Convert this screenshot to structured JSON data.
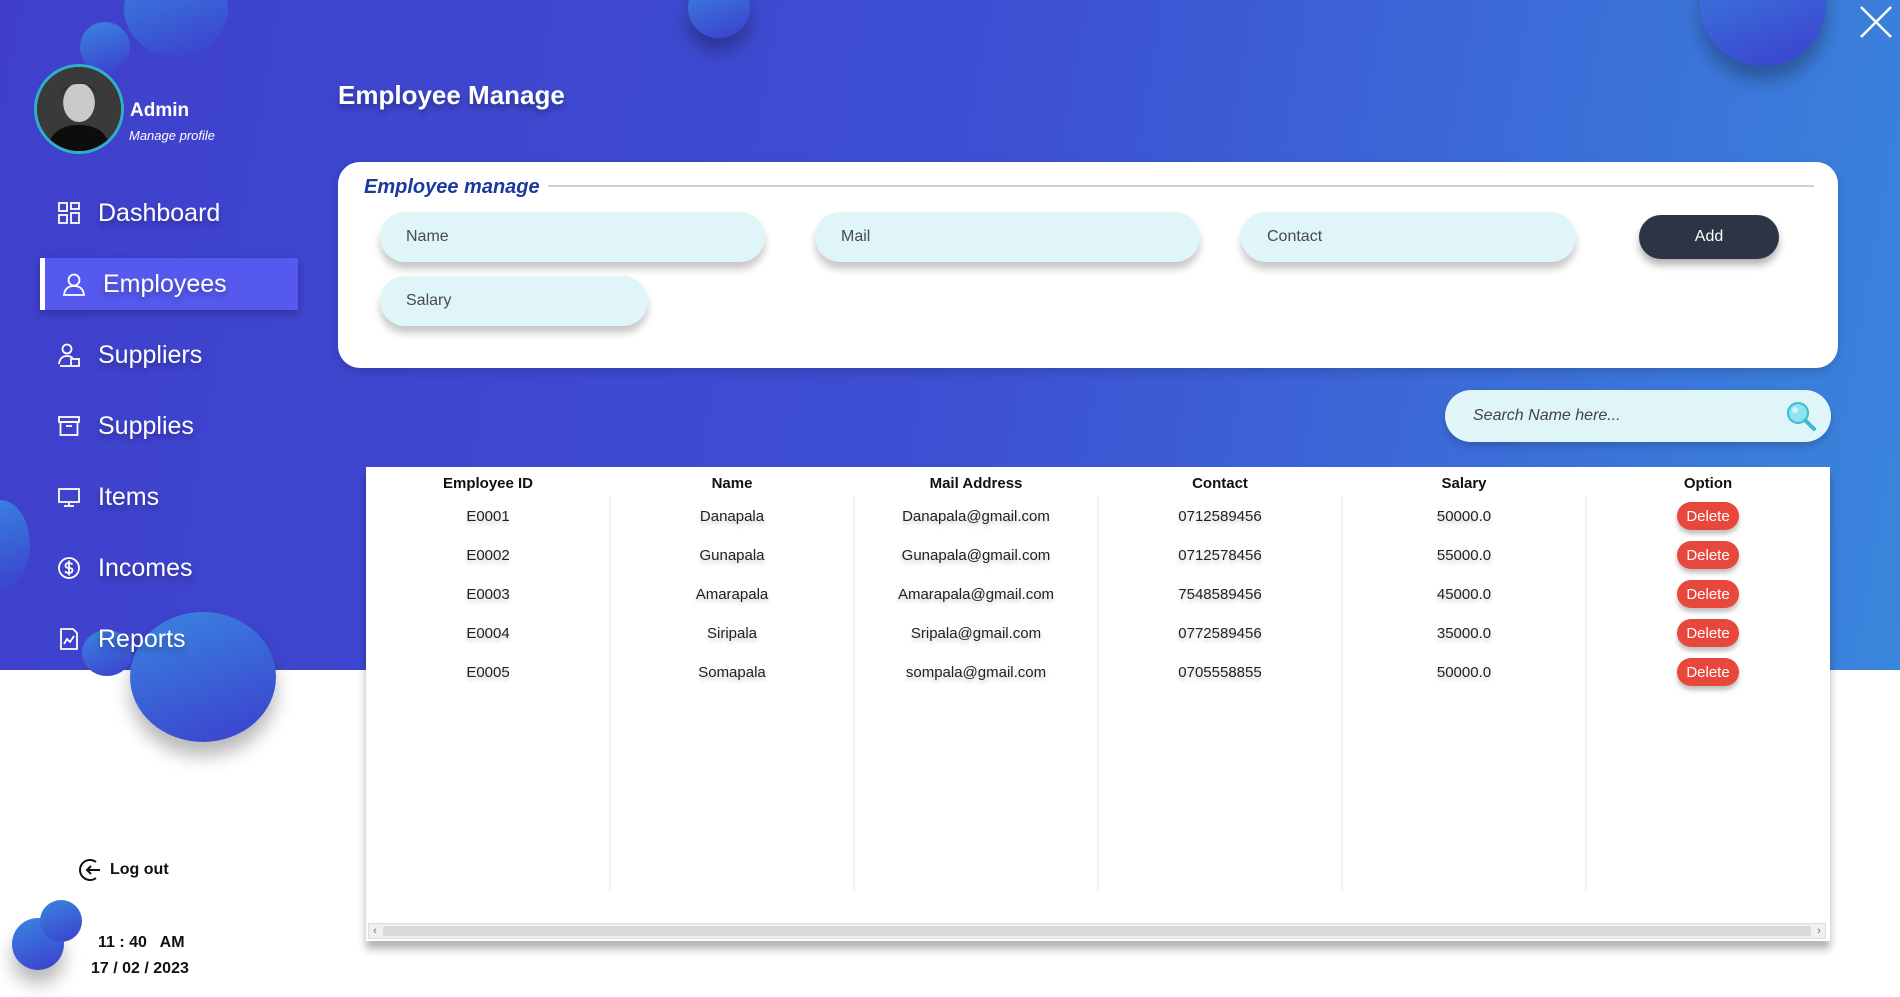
{
  "profile": {
    "name": "Admin",
    "manage_label": "Manage profile"
  },
  "nav": [
    {
      "label": "Dashboard",
      "icon": "dashboard-icon"
    },
    {
      "label": "Employees",
      "icon": "user-icon",
      "active": true
    },
    {
      "label": "Suppliers",
      "icon": "supplier-icon"
    },
    {
      "label": "Supplies",
      "icon": "box-icon"
    },
    {
      "label": "Items",
      "icon": "monitor-icon"
    },
    {
      "label": "Incomes",
      "icon": "dollar-icon"
    },
    {
      "label": "Reports",
      "icon": "report-icon"
    }
  ],
  "logout_label": "Log out",
  "clock": "11 : 40   AM",
  "date": "17 / 02 / 2023",
  "page_title": "Employee Manage",
  "form": {
    "legend": "Employee manage",
    "name_placeholder": "Name",
    "mail_placeholder": "Mail",
    "contact_placeholder": "Contact",
    "salary_placeholder": "Salary",
    "add_label": "Add"
  },
  "search": {
    "placeholder": "Search Name here..."
  },
  "table": {
    "columns": [
      "Employee ID",
      "Name",
      "Mail Address",
      "Contact",
      "Salary",
      "Option"
    ],
    "rows": [
      [
        "E0001",
        "Danapala",
        "Danapala@gmail.com",
        "0712589456",
        "50000.0"
      ],
      [
        "E0002",
        "Gunapala",
        "Gunapala@gmail.com",
        "0712578456",
        "55000.0"
      ],
      [
        "E0003",
        "Amarapala",
        "Amarapala@gmail.com",
        "7548589456",
        "45000.0"
      ],
      [
        "E0004",
        "Siripala",
        "Sripala@gmail.com",
        "0772589456",
        "35000.0"
      ],
      [
        "E0005",
        "Somapala",
        "sompala@gmail.com",
        "0705558855",
        "50000.0"
      ]
    ],
    "delete_label": "Delete"
  },
  "colors": {
    "accent": "#3f3fcc",
    "active_nav": "#5659ee",
    "delete": "#e8483c",
    "add_button": "#2d3445",
    "field_bg": "#dff5f8"
  }
}
